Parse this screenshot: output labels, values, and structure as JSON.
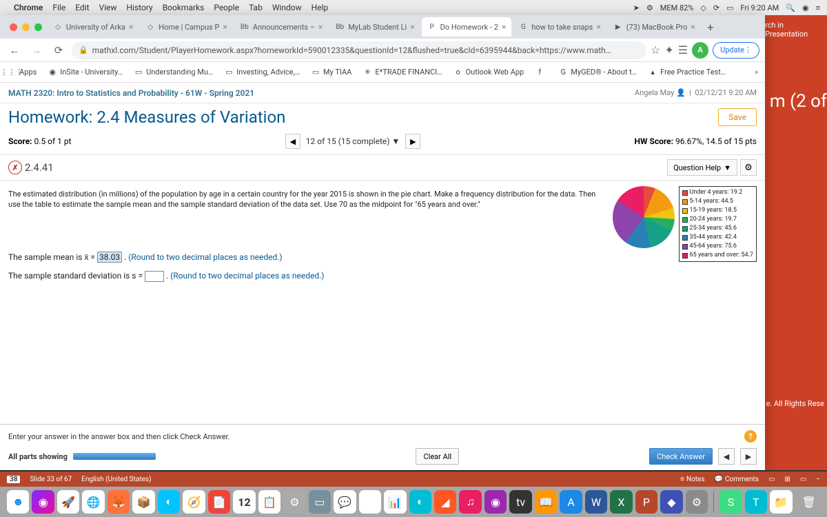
{
  "mac_menu": {
    "app": "Chrome",
    "items": [
      "File",
      "Edit",
      "View",
      "History",
      "Bookmarks",
      "People",
      "Tab",
      "Window",
      "Help"
    ],
    "mem": "MEM 82%",
    "time": "Fri 9:20 AM"
  },
  "tabs": [
    {
      "label": "University of Arka",
      "icon": "◇"
    },
    {
      "label": "Home | Campus P",
      "icon": "◇"
    },
    {
      "label": "Announcements –",
      "icon": "Bb"
    },
    {
      "label": "MyLab Student Li",
      "icon": "Bb"
    },
    {
      "label": "Do Homework - 2",
      "icon": "P",
      "active": true
    },
    {
      "label": "how to take snaps",
      "icon": "G"
    },
    {
      "label": "(73) MacBook Pro",
      "icon": "▶"
    }
  ],
  "url": "mathxl.com/Student/PlayerHomework.aspx?homeworkId=590012335&questionId=12&flushed=true&cId=6395944&back=https://www.math…",
  "update_label": "Update",
  "avatar_letter": "A",
  "bookmarks": [
    {
      "label": "Apps",
      "icon": "⋮⋮⋮"
    },
    {
      "label": "InSite - University…",
      "icon": "◉"
    },
    {
      "label": "Understanding Mu…",
      "icon": "▭"
    },
    {
      "label": "Investing, Advice,…",
      "icon": "▭"
    },
    {
      "label": "My TIAA",
      "icon": "▭"
    },
    {
      "label": "E*TRADE FINANCI…",
      "icon": "✳"
    },
    {
      "label": "Outlook Web App",
      "icon": "o"
    },
    {
      "label": "",
      "icon": "f"
    },
    {
      "label": "MyGED® - About t…",
      "icon": "G"
    },
    {
      "label": "Free Practice Test…",
      "icon": "▴"
    }
  ],
  "course": {
    "title": "MATH 2320: Intro to Statistics and Probability - 61W - Spring 2021",
    "user": "Angela May",
    "datetime": "02/12/21 9:20 AM"
  },
  "hw": {
    "title": "Homework: 2.4 Measures of Variation",
    "save": "Save",
    "score_label": "Score:",
    "score_value": "0.5 of 1 pt",
    "progress": "12 of 15 (15 complete)",
    "hw_score_label": "HW Score:",
    "hw_score_value": "96.67%, 14.5 of 15 pts"
  },
  "question": {
    "number": "2.4.41",
    "help_label": "Question Help",
    "prompt": "The estimated distribution (in millions) of the population by age in a certain country for the year 2015 is shown in the pie chart. Make a frequency distribution for the data. Then use the table to estimate the sample mean and the sample standard deviation of the data set. Use 70 as the midpoint for \"65 years and over.\"",
    "mean_line_pre": "The sample mean is x̄ = ",
    "mean_value": "38.03",
    "mean_line_post": ". ",
    "sd_line_pre": "The sample standard deviation is s = ",
    "sd_line_post": ". ",
    "round_hint": "(Round to two decimal places as needed.)"
  },
  "chart_data": {
    "type": "pie",
    "title": "",
    "series": [
      {
        "name": "Under 4 years",
        "value": 19.2,
        "color": "#e74c3c"
      },
      {
        "name": "5-14 years",
        "value": 44.5,
        "color": "#f39c12"
      },
      {
        "name": "15-19 years",
        "value": 18.5,
        "color": "#f1c40f"
      },
      {
        "name": "20-24 years",
        "value": 19.7,
        "color": "#27ae60"
      },
      {
        "name": "25-34 years",
        "value": 45.6,
        "color": "#16a085"
      },
      {
        "name": "35-44 years",
        "value": 42.4,
        "color": "#2980b9"
      },
      {
        "name": "45-64 years",
        "value": 75.6,
        "color": "#8e44ad"
      },
      {
        "name": "65 years and over",
        "value": 54.7,
        "color": "#e91e63"
      }
    ]
  },
  "footer": {
    "instruction": "Enter your answer in the answer box and then click Check Answer.",
    "parts": "All parts showing",
    "clear": "Clear All",
    "check": "Check Answer"
  },
  "ppt": {
    "slide": "38",
    "slide_of": "Slide 33 of 67",
    "lang": "English (United States)",
    "notes": "Notes",
    "comments": "Comments"
  },
  "peek": {
    "top": "rch in Presentation",
    "big": "m (2 of",
    "rights": "e. All Rights Rese"
  }
}
